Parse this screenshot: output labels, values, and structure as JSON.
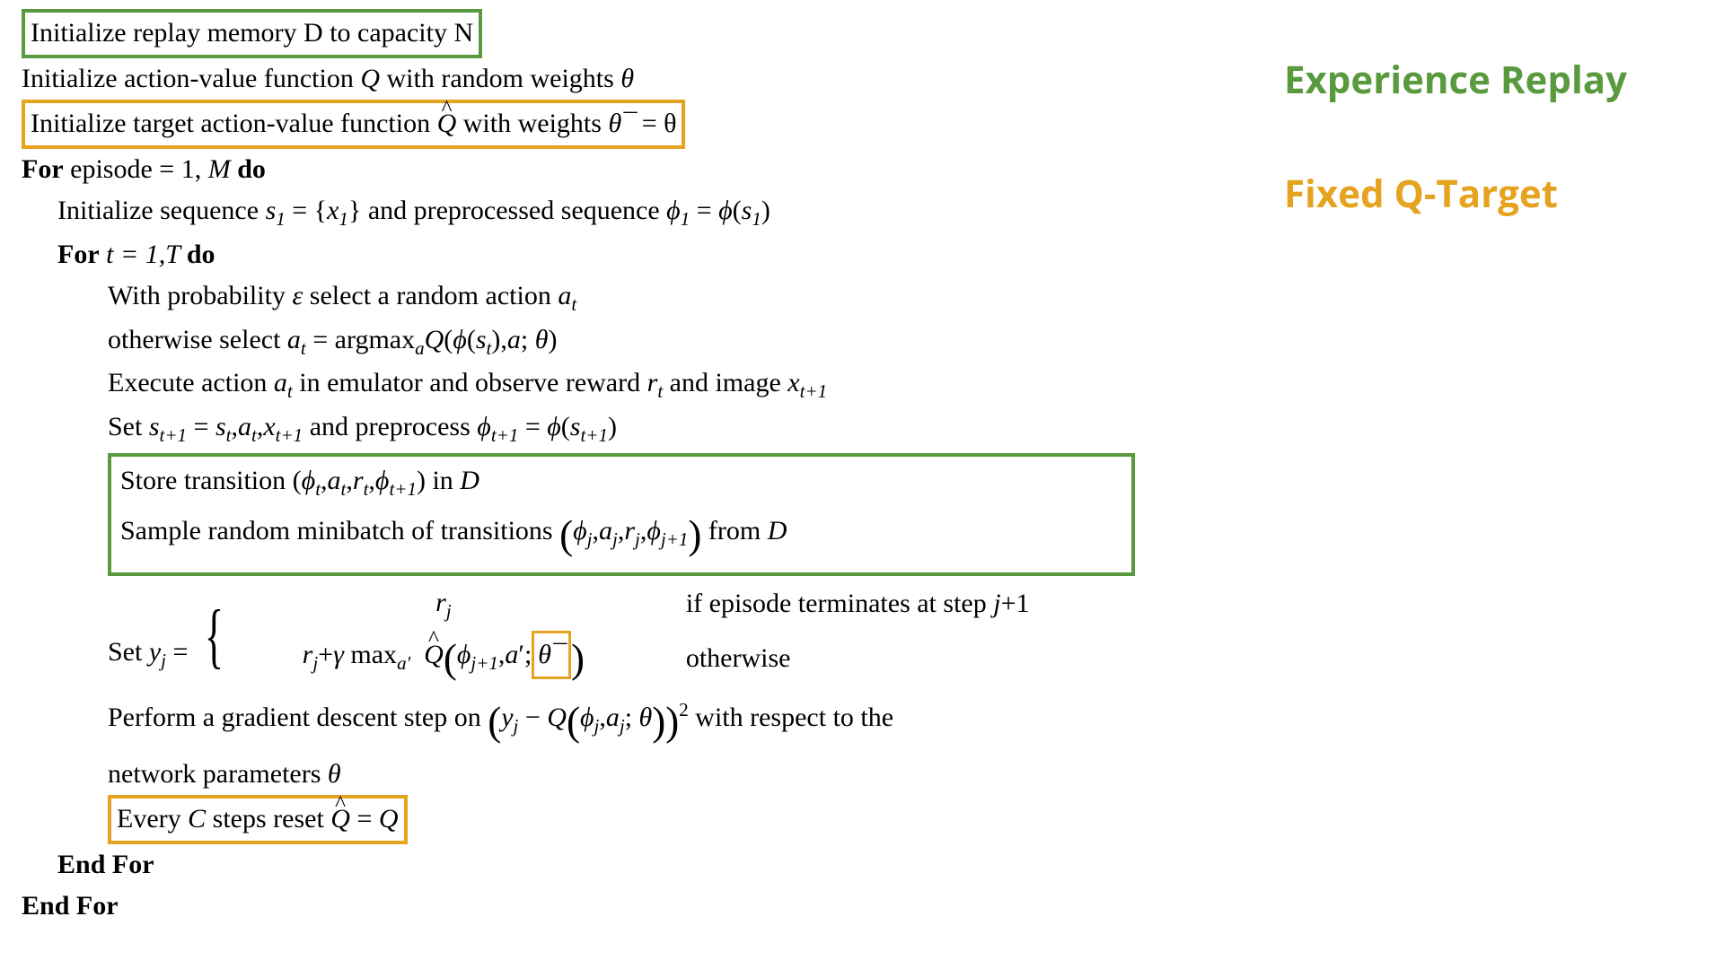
{
  "legend": {
    "experience_replay": "Experience Replay",
    "fixed_q_target": "Fixed Q-Target"
  },
  "algo": {
    "l1": "Initialize replay memory D to capacity N",
    "l2_a": "Initialize action-value function ",
    "l2_b": " with random weights ",
    "l3_a": "Initialize target action-value function ",
    "l3_b": " with weights ",
    "for_ep_a": "For",
    "for_ep_b": " episode = 1, ",
    "for_ep_c": " do",
    "l5_a": "Initialize sequence ",
    "l5_b": " and preprocessed sequence ",
    "for_t_a": "For",
    "for_t_c": " do",
    "l7_a": "With probability ",
    "l7_b": " select a random action ",
    "l8_a": "otherwise select ",
    "l8_b": " = argmax",
    "l9_a": "Execute action ",
    "l9_b": " in emulator and observe reward ",
    "l9_c": " and image ",
    "l10_a": "Set ",
    "l10_b": " and preprocess ",
    "l11_a": "Store transition ",
    "l11_b": " in ",
    "l12_a": "Sample random minibatch of transitions ",
    "l12_b": " from ",
    "l13_a": "Set ",
    "case1_cond": "if  episode  terminates at step ",
    "case2_cond": "otherwise",
    "case2_expr_a": " max",
    "l14_a": "Perform a gradient descent step on ",
    "l14_b": " with respect to the",
    "l15": "network parameters ",
    "l16_a": "Every ",
    "l16_b": " steps reset ",
    "endfor1": "End For",
    "endfor2": "End For"
  },
  "sym": {
    "D": "D",
    "N": "N",
    "Q": "Q",
    "theta": "θ",
    "theta_minus": "θ¯",
    "M": "M",
    "s1": "s",
    "x1": "x",
    "phi": "ϕ",
    "t": "t",
    "T": "T",
    "eps": "ε",
    "a": "a",
    "r": "r",
    "x": "x",
    "s": "s",
    "j": "j",
    "gamma": "γ",
    "C": "C",
    "y": "y",
    "one": "1",
    "eq": " = ",
    "eq_theta": " = θ",
    "t_eq_1T": " t = 1,T ",
    "t1": "t+1",
    "j1": "j+1",
    "aprime": "a′"
  }
}
